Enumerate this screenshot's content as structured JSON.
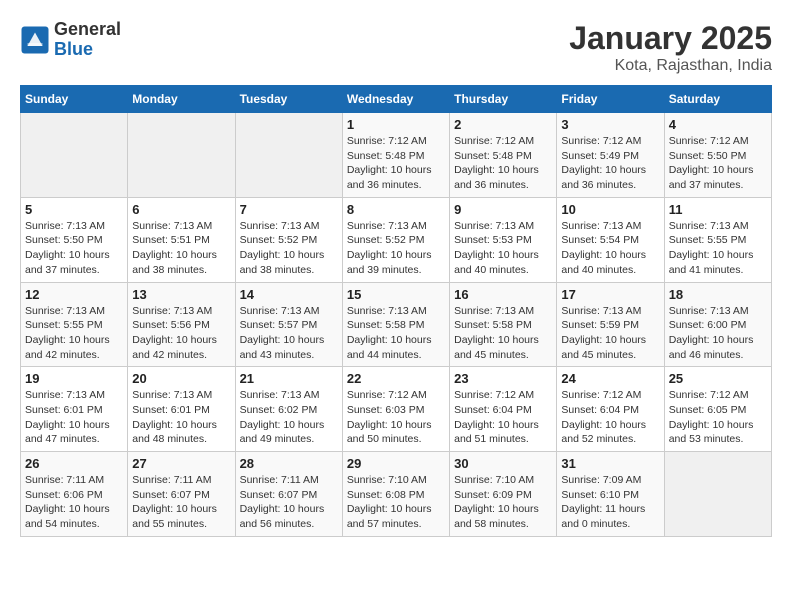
{
  "header": {
    "logo_general": "General",
    "logo_blue": "Blue",
    "title": "January 2025",
    "subtitle": "Kota, Rajasthan, India"
  },
  "weekdays": [
    "Sunday",
    "Monday",
    "Tuesday",
    "Wednesday",
    "Thursday",
    "Friday",
    "Saturday"
  ],
  "weeks": [
    [
      {
        "day": "",
        "info": ""
      },
      {
        "day": "",
        "info": ""
      },
      {
        "day": "",
        "info": ""
      },
      {
        "day": "1",
        "info": "Sunrise: 7:12 AM\nSunset: 5:48 PM\nDaylight: 10 hours\nand 36 minutes."
      },
      {
        "day": "2",
        "info": "Sunrise: 7:12 AM\nSunset: 5:48 PM\nDaylight: 10 hours\nand 36 minutes."
      },
      {
        "day": "3",
        "info": "Sunrise: 7:12 AM\nSunset: 5:49 PM\nDaylight: 10 hours\nand 36 minutes."
      },
      {
        "day": "4",
        "info": "Sunrise: 7:12 AM\nSunset: 5:50 PM\nDaylight: 10 hours\nand 37 minutes."
      }
    ],
    [
      {
        "day": "5",
        "info": "Sunrise: 7:13 AM\nSunset: 5:50 PM\nDaylight: 10 hours\nand 37 minutes."
      },
      {
        "day": "6",
        "info": "Sunrise: 7:13 AM\nSunset: 5:51 PM\nDaylight: 10 hours\nand 38 minutes."
      },
      {
        "day": "7",
        "info": "Sunrise: 7:13 AM\nSunset: 5:52 PM\nDaylight: 10 hours\nand 38 minutes."
      },
      {
        "day": "8",
        "info": "Sunrise: 7:13 AM\nSunset: 5:52 PM\nDaylight: 10 hours\nand 39 minutes."
      },
      {
        "day": "9",
        "info": "Sunrise: 7:13 AM\nSunset: 5:53 PM\nDaylight: 10 hours\nand 40 minutes."
      },
      {
        "day": "10",
        "info": "Sunrise: 7:13 AM\nSunset: 5:54 PM\nDaylight: 10 hours\nand 40 minutes."
      },
      {
        "day": "11",
        "info": "Sunrise: 7:13 AM\nSunset: 5:55 PM\nDaylight: 10 hours\nand 41 minutes."
      }
    ],
    [
      {
        "day": "12",
        "info": "Sunrise: 7:13 AM\nSunset: 5:55 PM\nDaylight: 10 hours\nand 42 minutes."
      },
      {
        "day": "13",
        "info": "Sunrise: 7:13 AM\nSunset: 5:56 PM\nDaylight: 10 hours\nand 42 minutes."
      },
      {
        "day": "14",
        "info": "Sunrise: 7:13 AM\nSunset: 5:57 PM\nDaylight: 10 hours\nand 43 minutes."
      },
      {
        "day": "15",
        "info": "Sunrise: 7:13 AM\nSunset: 5:58 PM\nDaylight: 10 hours\nand 44 minutes."
      },
      {
        "day": "16",
        "info": "Sunrise: 7:13 AM\nSunset: 5:58 PM\nDaylight: 10 hours\nand 45 minutes."
      },
      {
        "day": "17",
        "info": "Sunrise: 7:13 AM\nSunset: 5:59 PM\nDaylight: 10 hours\nand 45 minutes."
      },
      {
        "day": "18",
        "info": "Sunrise: 7:13 AM\nSunset: 6:00 PM\nDaylight: 10 hours\nand 46 minutes."
      }
    ],
    [
      {
        "day": "19",
        "info": "Sunrise: 7:13 AM\nSunset: 6:01 PM\nDaylight: 10 hours\nand 47 minutes."
      },
      {
        "day": "20",
        "info": "Sunrise: 7:13 AM\nSunset: 6:01 PM\nDaylight: 10 hours\nand 48 minutes."
      },
      {
        "day": "21",
        "info": "Sunrise: 7:13 AM\nSunset: 6:02 PM\nDaylight: 10 hours\nand 49 minutes."
      },
      {
        "day": "22",
        "info": "Sunrise: 7:12 AM\nSunset: 6:03 PM\nDaylight: 10 hours\nand 50 minutes."
      },
      {
        "day": "23",
        "info": "Sunrise: 7:12 AM\nSunset: 6:04 PM\nDaylight: 10 hours\nand 51 minutes."
      },
      {
        "day": "24",
        "info": "Sunrise: 7:12 AM\nSunset: 6:04 PM\nDaylight: 10 hours\nand 52 minutes."
      },
      {
        "day": "25",
        "info": "Sunrise: 7:12 AM\nSunset: 6:05 PM\nDaylight: 10 hours\nand 53 minutes."
      }
    ],
    [
      {
        "day": "26",
        "info": "Sunrise: 7:11 AM\nSunset: 6:06 PM\nDaylight: 10 hours\nand 54 minutes."
      },
      {
        "day": "27",
        "info": "Sunrise: 7:11 AM\nSunset: 6:07 PM\nDaylight: 10 hours\nand 55 minutes."
      },
      {
        "day": "28",
        "info": "Sunrise: 7:11 AM\nSunset: 6:07 PM\nDaylight: 10 hours\nand 56 minutes."
      },
      {
        "day": "29",
        "info": "Sunrise: 7:10 AM\nSunset: 6:08 PM\nDaylight: 10 hours\nand 57 minutes."
      },
      {
        "day": "30",
        "info": "Sunrise: 7:10 AM\nSunset: 6:09 PM\nDaylight: 10 hours\nand 58 minutes."
      },
      {
        "day": "31",
        "info": "Sunrise: 7:09 AM\nSunset: 6:10 PM\nDaylight: 11 hours\nand 0 minutes."
      },
      {
        "day": "",
        "info": ""
      }
    ]
  ]
}
